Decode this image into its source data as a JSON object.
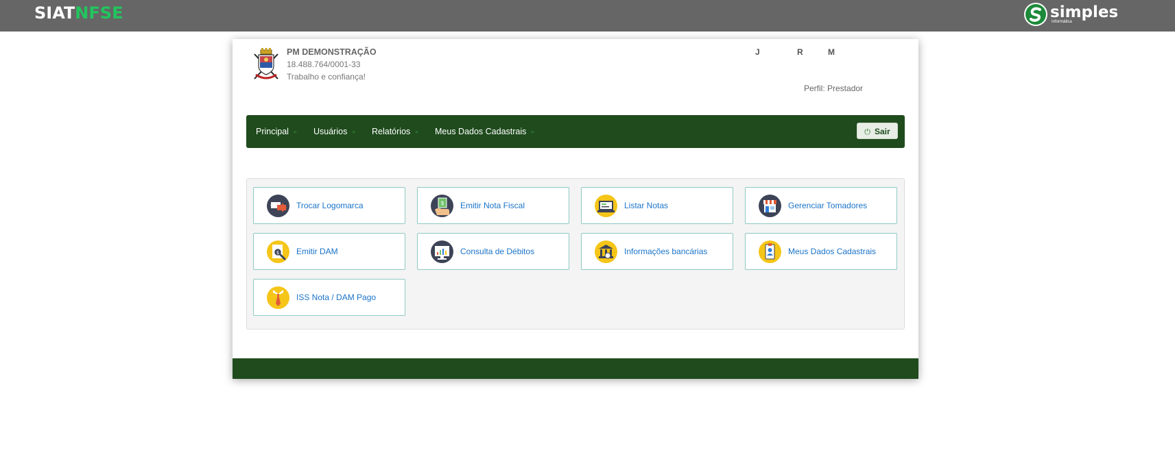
{
  "header": {
    "brand_part1": "SIAT",
    "brand_part2": "NFSE",
    "vendor_name": "simples",
    "vendor_subtitle": "Informática"
  },
  "org": {
    "name": "PM DEMONSTRAÇÃO",
    "cnpj": "18.488.764/0001-33",
    "slogan": "Trabalho e confiança!"
  },
  "user": {
    "initials": [
      "J",
      "R",
      "M"
    ],
    "perfil_label": "Perfil: Prestador"
  },
  "nav": {
    "items": [
      {
        "label": "Principal"
      },
      {
        "label": "Usuários"
      },
      {
        "label": "Relatórios"
      },
      {
        "label": "Meus Dados Cadastrais"
      }
    ],
    "logout_label": "Sair"
  },
  "tiles": [
    {
      "label": "Trocar Logomarca",
      "icon": "swap-logo-icon"
    },
    {
      "label": "Emitir Nota Fiscal",
      "icon": "issue-invoice-icon"
    },
    {
      "label": "Listar Notas",
      "icon": "list-invoices-icon"
    },
    {
      "label": "Gerenciar Tomadores",
      "icon": "store-icon"
    },
    {
      "label": "Emitir DAM",
      "icon": "search-document-icon"
    },
    {
      "label": "Consulta de Débitos",
      "icon": "chart-monitor-icon"
    },
    {
      "label": "Informações bancárias",
      "icon": "bank-icon"
    },
    {
      "label": "Meus Dados Cadastrais",
      "icon": "id-badge-icon"
    },
    {
      "label": "ISS Nota / DAM Pago",
      "icon": "tie-icon"
    }
  ],
  "colors": {
    "topbar": "#666666",
    "nav_green": "#1f4b1d",
    "brand_green": "#22c55e",
    "tile_link": "#1a73c8",
    "tile_border": "#8fc9c3"
  }
}
